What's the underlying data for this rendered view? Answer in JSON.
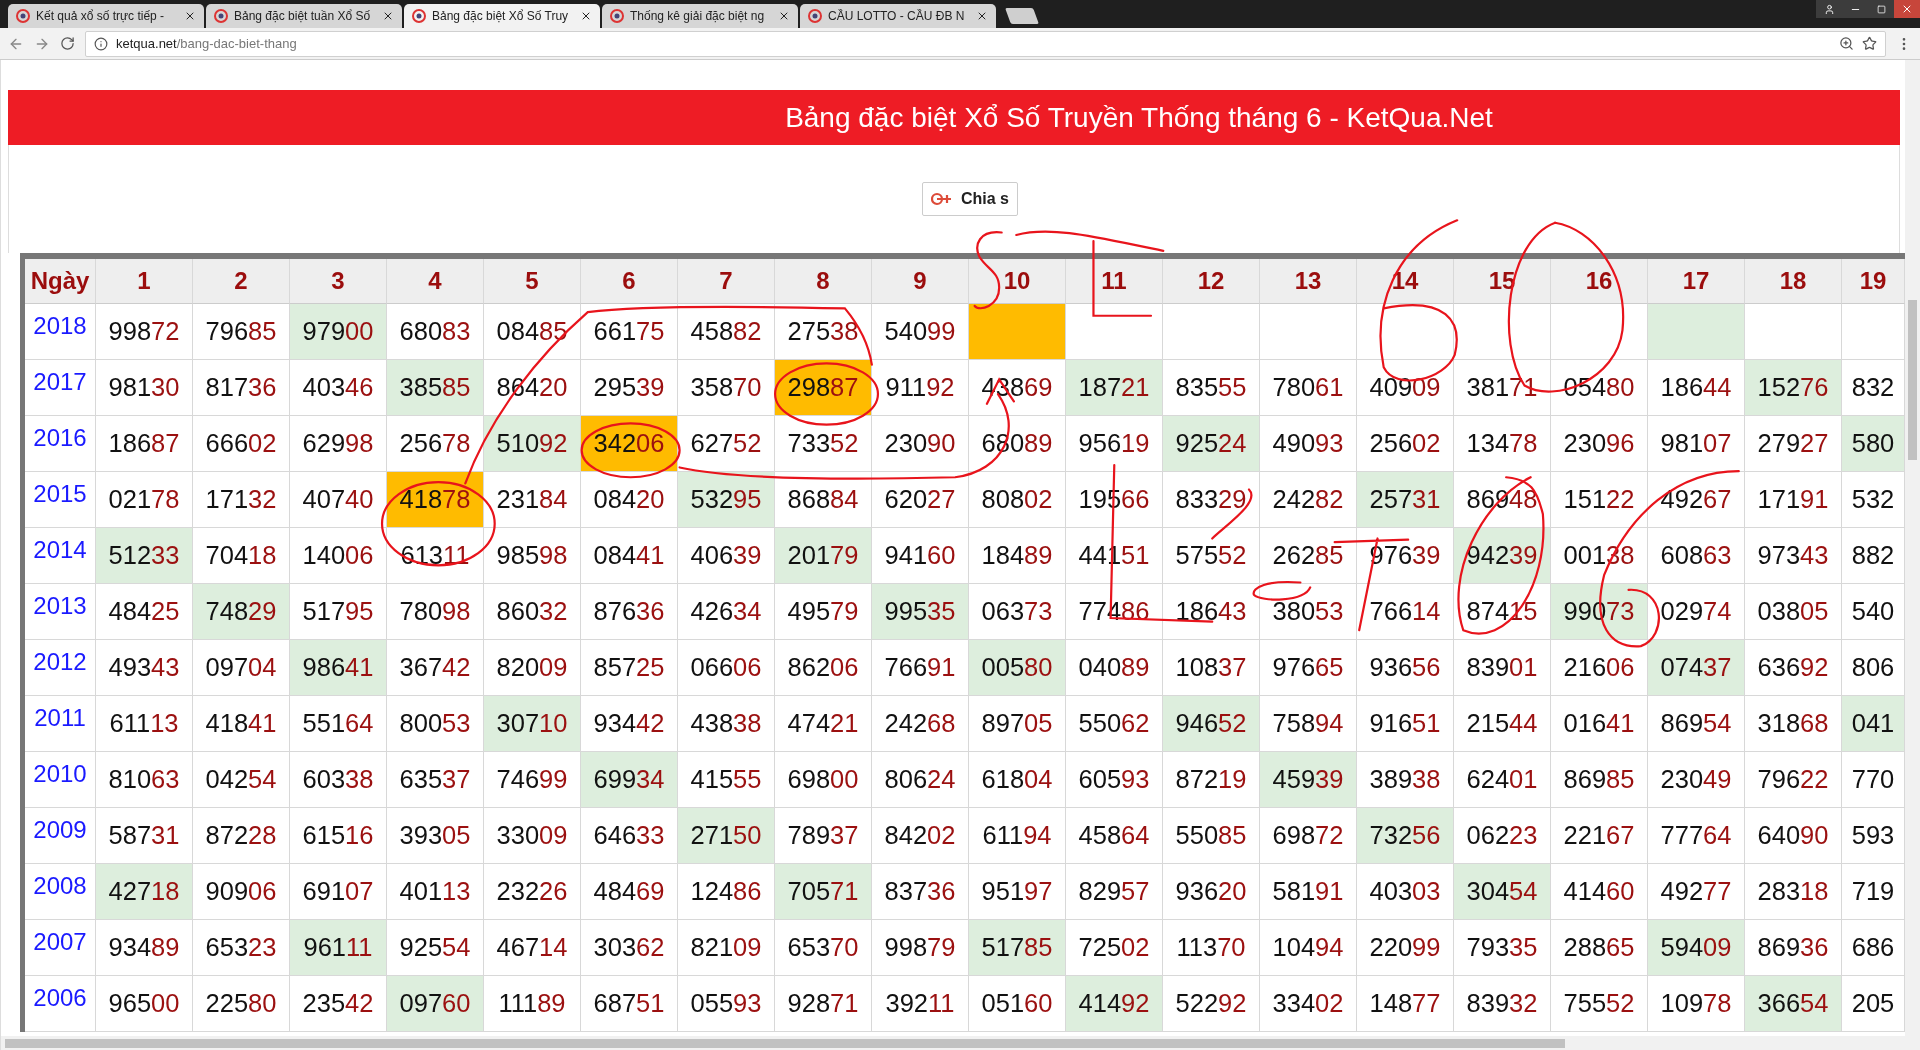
{
  "browser": {
    "tabs": [
      {
        "title": "Kết quả xổ số trực tiếp -",
        "selected": false
      },
      {
        "title": "Bảng đặc biệt tuần Xổ Số",
        "selected": false
      },
      {
        "title": "Bảng đặc biệt Xổ Số Truy",
        "selected": true
      },
      {
        "title": "Thống kê giải đặc biệt ng",
        "selected": false
      },
      {
        "title": "CẦU LOTTO - CẦU ĐB N",
        "selected": false
      }
    ],
    "address": {
      "domain": "ketqua.net",
      "path": "/bang-dac-biet-thang"
    }
  },
  "banner": {
    "title": "Bảng đặc biệt Xổ Số Truyền Thống tháng 6 - KetQua.Net"
  },
  "share_button": {
    "label": "Chia s"
  },
  "table": {
    "columns": [
      "Ngày",
      "1",
      "2",
      "3",
      "4",
      "5",
      "6",
      "7",
      "8",
      "9",
      "10",
      "11",
      "12",
      "13",
      "14",
      "15",
      "16",
      "17",
      "18",
      "19"
    ],
    "rows": [
      {
        "cells": [
          {
            "kind": "year",
            "value": "2018"
          },
          {
            "kind": "number",
            "value": "99872",
            "color": "#ffffff"
          },
          {
            "kind": "number",
            "value": "79685",
            "color": "#ffffff"
          },
          {
            "kind": "number",
            "value": "97900",
            "color": "#ddeedd"
          },
          {
            "kind": "number",
            "value": "68083",
            "color": "#ffffff"
          },
          {
            "kind": "number",
            "value": "08485",
            "color": "#ffffff"
          },
          {
            "kind": "number",
            "value": "66175",
            "color": "#ffffff"
          },
          {
            "kind": "number",
            "value": "45882",
            "color": "#ffffff"
          },
          {
            "kind": "number",
            "value": "27538",
            "color": "#ffffff"
          },
          {
            "kind": "number",
            "value": "54099",
            "color": "#ffffff"
          },
          {
            "kind": "number",
            "color": "#ffbb00"
          },
          {
            "kind": "number",
            "color": "#ffffff"
          },
          {
            "kind": "number",
            "color": "#ffffff"
          },
          {
            "kind": "number",
            "color": "#ffffff"
          },
          {
            "kind": "number",
            "color": "#ffffff"
          },
          {
            "kind": "number",
            "color": "#ffffff"
          },
          {
            "kind": "number",
            "color": "#ffffff"
          },
          {
            "kind": "number",
            "color": "#ddeedd"
          },
          {
            "kind": "number",
            "color": "#ffffff"
          },
          {
            "kind": "number",
            "color": "#ffffff"
          }
        ]
      },
      {
        "cells": [
          {
            "kind": "year",
            "value": "2017"
          },
          {
            "kind": "number",
            "value": "98130",
            "color": "#ffffff"
          },
          {
            "kind": "number",
            "value": "81736",
            "color": "#ffffff"
          },
          {
            "kind": "number",
            "value": "40346",
            "color": "#ffffff"
          },
          {
            "kind": "number",
            "value": "38585",
            "color": "#ddeedd"
          },
          {
            "kind": "number",
            "value": "86420",
            "color": "#ffffff"
          },
          {
            "kind": "number",
            "value": "29539",
            "color": "#ffffff"
          },
          {
            "kind": "number",
            "value": "35870",
            "color": "#ffffff"
          },
          {
            "kind": "number",
            "value": "29887",
            "color": "#ffbb00"
          },
          {
            "kind": "number",
            "value": "91192",
            "color": "#ffffff"
          },
          {
            "kind": "number",
            "value": "43869",
            "color": "#ffffff"
          },
          {
            "kind": "number",
            "value": "18721",
            "color": "#ddeedd"
          },
          {
            "kind": "number",
            "value": "83555",
            "color": "#ffffff"
          },
          {
            "kind": "number",
            "value": "78061",
            "color": "#ffffff"
          },
          {
            "kind": "number",
            "value": "40909",
            "color": "#ffffff"
          },
          {
            "kind": "number",
            "value": "38171",
            "color": "#ffffff"
          },
          {
            "kind": "number",
            "value": "05480",
            "color": "#ffffff"
          },
          {
            "kind": "number",
            "value": "18644",
            "color": "#ffffff"
          },
          {
            "kind": "number",
            "value": "15276",
            "color": "#ddeedd"
          },
          {
            "kind": "number",
            "value": "832",
            "color": "#ffffff"
          }
        ]
      },
      {
        "cells": [
          {
            "kind": "year",
            "value": "2016"
          },
          {
            "kind": "number",
            "value": "18687",
            "color": "#ffffff"
          },
          {
            "kind": "number",
            "value": "66602",
            "color": "#ffffff"
          },
          {
            "kind": "number",
            "value": "62998",
            "color": "#ffffff"
          },
          {
            "kind": "number",
            "value": "25678",
            "color": "#ffffff"
          },
          {
            "kind": "number",
            "value": "51092",
            "color": "#ddeedd"
          },
          {
            "kind": "number",
            "value": "34206",
            "color": "#ffbb00"
          },
          {
            "kind": "number",
            "value": "62752",
            "color": "#ffffff"
          },
          {
            "kind": "number",
            "value": "73352",
            "color": "#ffffff"
          },
          {
            "kind": "number",
            "value": "23090",
            "color": "#ffffff"
          },
          {
            "kind": "number",
            "value": "68089",
            "color": "#ffffff"
          },
          {
            "kind": "number",
            "value": "95619",
            "color": "#ffffff"
          },
          {
            "kind": "number",
            "value": "92524",
            "color": "#ddeedd"
          },
          {
            "kind": "number",
            "value": "49093",
            "color": "#ffffff"
          },
          {
            "kind": "number",
            "value": "25602",
            "color": "#ffffff"
          },
          {
            "kind": "number",
            "value": "13478",
            "color": "#ffffff"
          },
          {
            "kind": "number",
            "value": "23096",
            "color": "#ffffff"
          },
          {
            "kind": "number",
            "value": "98107",
            "color": "#ffffff"
          },
          {
            "kind": "number",
            "value": "27927",
            "color": "#ffffff"
          },
          {
            "kind": "number",
            "value": "580",
            "color": "#ddeedd"
          }
        ]
      },
      {
        "cells": [
          {
            "kind": "year",
            "value": "2015"
          },
          {
            "kind": "number",
            "value": "02178",
            "color": "#ffffff"
          },
          {
            "kind": "number",
            "value": "17132",
            "color": "#ffffff"
          },
          {
            "kind": "number",
            "value": "40740",
            "color": "#ffffff"
          },
          {
            "kind": "number",
            "value": "41878",
            "color": "#ffbb00"
          },
          {
            "kind": "number",
            "value": "23184",
            "color": "#ffffff"
          },
          {
            "kind": "number",
            "value": "08420",
            "color": "#ffffff"
          },
          {
            "kind": "number",
            "value": "53295",
            "color": "#ddeedd"
          },
          {
            "kind": "number",
            "value": "86884",
            "color": "#ffffff"
          },
          {
            "kind": "number",
            "value": "62027",
            "color": "#ffffff"
          },
          {
            "kind": "number",
            "value": "80802",
            "color": "#ffffff"
          },
          {
            "kind": "number",
            "value": "19566",
            "color": "#ffffff"
          },
          {
            "kind": "number",
            "value": "83329",
            "color": "#ffffff"
          },
          {
            "kind": "number",
            "value": "24282",
            "color": "#ffffff"
          },
          {
            "kind": "number",
            "value": "25731",
            "color": "#ddeedd"
          },
          {
            "kind": "number",
            "value": "86948",
            "color": "#ffffff"
          },
          {
            "kind": "number",
            "value": "15122",
            "color": "#ffffff"
          },
          {
            "kind": "number",
            "value": "49267",
            "color": "#ffffff"
          },
          {
            "kind": "number",
            "value": "17191",
            "color": "#ffffff"
          },
          {
            "kind": "number",
            "value": "532",
            "color": "#ffffff"
          }
        ]
      },
      {
        "cells": [
          {
            "kind": "year",
            "value": "2014"
          },
          {
            "kind": "number",
            "value": "51233",
            "color": "#ddeedd"
          },
          {
            "kind": "number",
            "value": "70418",
            "color": "#ffffff"
          },
          {
            "kind": "number",
            "value": "14006",
            "color": "#ffffff"
          },
          {
            "kind": "number",
            "value": "61311",
            "color": "#ffffff"
          },
          {
            "kind": "number",
            "value": "98598",
            "color": "#ffffff"
          },
          {
            "kind": "number",
            "value": "08441",
            "color": "#ffffff"
          },
          {
            "kind": "number",
            "value": "40639",
            "color": "#ffffff"
          },
          {
            "kind": "number",
            "value": "20179",
            "color": "#ddeedd"
          },
          {
            "kind": "number",
            "value": "94160",
            "color": "#ffffff"
          },
          {
            "kind": "number",
            "value": "18489",
            "color": "#ffffff"
          },
          {
            "kind": "number",
            "value": "44151",
            "color": "#ffffff"
          },
          {
            "kind": "number",
            "value": "57552",
            "color": "#ffffff"
          },
          {
            "kind": "number",
            "value": "26285",
            "color": "#ffffff"
          },
          {
            "kind": "number",
            "value": "97639",
            "color": "#ffffff"
          },
          {
            "kind": "number",
            "value": "94239",
            "color": "#ddeedd"
          },
          {
            "kind": "number",
            "value": "00138",
            "color": "#ffffff"
          },
          {
            "kind": "number",
            "value": "60863",
            "color": "#ffffff"
          },
          {
            "kind": "number",
            "value": "97343",
            "color": "#ffffff"
          },
          {
            "kind": "number",
            "value": "882",
            "color": "#ffffff"
          }
        ]
      },
      {
        "cells": [
          {
            "kind": "year",
            "value": "2013"
          },
          {
            "kind": "number",
            "value": "48425",
            "color": "#ffffff"
          },
          {
            "kind": "number",
            "value": "74829",
            "color": "#ddeedd"
          },
          {
            "kind": "number",
            "value": "51795",
            "color": "#ffffff"
          },
          {
            "kind": "number",
            "value": "78098",
            "color": "#ffffff"
          },
          {
            "kind": "number",
            "value": "86032",
            "color": "#ffffff"
          },
          {
            "kind": "number",
            "value": "87636",
            "color": "#ffffff"
          },
          {
            "kind": "number",
            "value": "42634",
            "color": "#ffffff"
          },
          {
            "kind": "number",
            "value": "49579",
            "color": "#ffffff"
          },
          {
            "kind": "number",
            "value": "99535",
            "color": "#ddeedd"
          },
          {
            "kind": "number",
            "value": "06373",
            "color": "#ffffff"
          },
          {
            "kind": "number",
            "value": "77486",
            "color": "#ffffff"
          },
          {
            "kind": "number",
            "value": "18643",
            "color": "#ffffff"
          },
          {
            "kind": "number",
            "value": "38053",
            "color": "#ffffff"
          },
          {
            "kind": "number",
            "value": "76614",
            "color": "#ffffff"
          },
          {
            "kind": "number",
            "value": "87415",
            "color": "#ffffff"
          },
          {
            "kind": "number",
            "value": "99073",
            "color": "#ddeedd"
          },
          {
            "kind": "number",
            "value": "02974",
            "color": "#ffffff"
          },
          {
            "kind": "number",
            "value": "03805",
            "color": "#ffffff"
          },
          {
            "kind": "number",
            "value": "540",
            "color": "#ffffff"
          }
        ]
      },
      {
        "cells": [
          {
            "kind": "year",
            "value": "2012"
          },
          {
            "kind": "number",
            "value": "49343",
            "color": "#ffffff"
          },
          {
            "kind": "number",
            "value": "09704",
            "color": "#ffffff"
          },
          {
            "kind": "number",
            "value": "98641",
            "color": "#ddeedd"
          },
          {
            "kind": "number",
            "value": "36742",
            "color": "#ffffff"
          },
          {
            "kind": "number",
            "value": "82009",
            "color": "#ffffff"
          },
          {
            "kind": "number",
            "value": "85725",
            "color": "#ffffff"
          },
          {
            "kind": "number",
            "value": "06606",
            "color": "#ffffff"
          },
          {
            "kind": "number",
            "value": "86206",
            "color": "#ffffff"
          },
          {
            "kind": "number",
            "value": "76691",
            "color": "#ffffff"
          },
          {
            "kind": "number",
            "value": "00580",
            "color": "#ddeedd"
          },
          {
            "kind": "number",
            "value": "04089",
            "color": "#ffffff"
          },
          {
            "kind": "number",
            "value": "10837",
            "color": "#ffffff"
          },
          {
            "kind": "number",
            "value": "97665",
            "color": "#ffffff"
          },
          {
            "kind": "number",
            "value": "93656",
            "color": "#ffffff"
          },
          {
            "kind": "number",
            "value": "83901",
            "color": "#ffffff"
          },
          {
            "kind": "number",
            "value": "21606",
            "color": "#ffffff"
          },
          {
            "kind": "number",
            "value": "07437",
            "color": "#ddeedd"
          },
          {
            "kind": "number",
            "value": "63692",
            "color": "#ffffff"
          },
          {
            "kind": "number",
            "value": "806",
            "color": "#ffffff"
          }
        ]
      },
      {
        "cells": [
          {
            "kind": "year",
            "value": "2011"
          },
          {
            "kind": "number",
            "value": "61113",
            "color": "#ffffff"
          },
          {
            "kind": "number",
            "value": "41841",
            "color": "#ffffff"
          },
          {
            "kind": "number",
            "value": "55164",
            "color": "#ffffff"
          },
          {
            "kind": "number",
            "value": "80053",
            "color": "#ffffff"
          },
          {
            "kind": "number",
            "value": "30710",
            "color": "#ddeedd"
          },
          {
            "kind": "number",
            "value": "93442",
            "color": "#ffffff"
          },
          {
            "kind": "number",
            "value": "43838",
            "color": "#ffffff"
          },
          {
            "kind": "number",
            "value": "47421",
            "color": "#ffffff"
          },
          {
            "kind": "number",
            "value": "24268",
            "color": "#ffffff"
          },
          {
            "kind": "number",
            "value": "89705",
            "color": "#ffffff"
          },
          {
            "kind": "number",
            "value": "55062",
            "color": "#ffffff"
          },
          {
            "kind": "number",
            "value": "94652",
            "color": "#ddeedd"
          },
          {
            "kind": "number",
            "value": "75894",
            "color": "#ffffff"
          },
          {
            "kind": "number",
            "value": "91651",
            "color": "#ffffff"
          },
          {
            "kind": "number",
            "value": "21544",
            "color": "#ffffff"
          },
          {
            "kind": "number",
            "value": "01641",
            "color": "#ffffff"
          },
          {
            "kind": "number",
            "value": "86954",
            "color": "#ffffff"
          },
          {
            "kind": "number",
            "value": "31868",
            "color": "#ffffff"
          },
          {
            "kind": "number",
            "value": "041",
            "color": "#ddeedd"
          }
        ]
      },
      {
        "cells": [
          {
            "kind": "year",
            "value": "2010"
          },
          {
            "kind": "number",
            "value": "81063",
            "color": "#ffffff"
          },
          {
            "kind": "number",
            "value": "04254",
            "color": "#ffffff"
          },
          {
            "kind": "number",
            "value": "60338",
            "color": "#ffffff"
          },
          {
            "kind": "number",
            "value": "63537",
            "color": "#ffffff"
          },
          {
            "kind": "number",
            "value": "74699",
            "color": "#ffffff"
          },
          {
            "kind": "number",
            "value": "69934",
            "color": "#ddeedd"
          },
          {
            "kind": "number",
            "value": "41555",
            "color": "#ffffff"
          },
          {
            "kind": "number",
            "value": "69800",
            "color": "#ffffff"
          },
          {
            "kind": "number",
            "value": "80624",
            "color": "#ffffff"
          },
          {
            "kind": "number",
            "value": "61804",
            "color": "#ffffff"
          },
          {
            "kind": "number",
            "value": "60593",
            "color": "#ffffff"
          },
          {
            "kind": "number",
            "value": "87219",
            "color": "#ffffff"
          },
          {
            "kind": "number",
            "value": "45939",
            "color": "#ddeedd"
          },
          {
            "kind": "number",
            "value": "38938",
            "color": "#ffffff"
          },
          {
            "kind": "number",
            "value": "62401",
            "color": "#ffffff"
          },
          {
            "kind": "number",
            "value": "86985",
            "color": "#ffffff"
          },
          {
            "kind": "number",
            "value": "23049",
            "color": "#ffffff"
          },
          {
            "kind": "number",
            "value": "79622",
            "color": "#ffffff"
          },
          {
            "kind": "number",
            "value": "770",
            "color": "#ffffff"
          }
        ]
      },
      {
        "cells": [
          {
            "kind": "year",
            "value": "2009"
          },
          {
            "kind": "number",
            "value": "58731",
            "color": "#ffffff"
          },
          {
            "kind": "number",
            "value": "87228",
            "color": "#ffffff"
          },
          {
            "kind": "number",
            "value": "61516",
            "color": "#ffffff"
          },
          {
            "kind": "number",
            "value": "39305",
            "color": "#ffffff"
          },
          {
            "kind": "number",
            "value": "33009",
            "color": "#ffffff"
          },
          {
            "kind": "number",
            "value": "64633",
            "color": "#ffffff"
          },
          {
            "kind": "number",
            "value": "27150",
            "color": "#ddeedd"
          },
          {
            "kind": "number",
            "value": "78937",
            "color": "#ffffff"
          },
          {
            "kind": "number",
            "value": "84202",
            "color": "#ffffff"
          },
          {
            "kind": "number",
            "value": "61194",
            "color": "#ffffff"
          },
          {
            "kind": "number",
            "value": "45864",
            "color": "#ffffff"
          },
          {
            "kind": "number",
            "value": "55085",
            "color": "#ffffff"
          },
          {
            "kind": "number",
            "value": "69872",
            "color": "#ffffff"
          },
          {
            "kind": "number",
            "value": "73256",
            "color": "#ddeedd"
          },
          {
            "kind": "number",
            "value": "06223",
            "color": "#ffffff"
          },
          {
            "kind": "number",
            "value": "22167",
            "color": "#ffffff"
          },
          {
            "kind": "number",
            "value": "77764",
            "color": "#ffffff"
          },
          {
            "kind": "number",
            "value": "64090",
            "color": "#ffffff"
          },
          {
            "kind": "number",
            "value": "593",
            "color": "#ffffff"
          }
        ]
      },
      {
        "cells": [
          {
            "kind": "year",
            "value": "2008"
          },
          {
            "kind": "number",
            "value": "42718",
            "color": "#ddeedd"
          },
          {
            "kind": "number",
            "value": "90906",
            "color": "#ffffff"
          },
          {
            "kind": "number",
            "value": "69107",
            "color": "#ffffff"
          },
          {
            "kind": "number",
            "value": "40113",
            "color": "#ffffff"
          },
          {
            "kind": "number",
            "value": "23226",
            "color": "#ffffff"
          },
          {
            "kind": "number",
            "value": "48469",
            "color": "#ffffff"
          },
          {
            "kind": "number",
            "value": "12486",
            "color": "#ffffff"
          },
          {
            "kind": "number",
            "value": "70571",
            "color": "#ddeedd"
          },
          {
            "kind": "number",
            "value": "83736",
            "color": "#ffffff"
          },
          {
            "kind": "number",
            "value": "95197",
            "color": "#ffffff"
          },
          {
            "kind": "number",
            "value": "82957",
            "color": "#ffffff"
          },
          {
            "kind": "number",
            "value": "93620",
            "color": "#ffffff"
          },
          {
            "kind": "number",
            "value": "58191",
            "color": "#ffffff"
          },
          {
            "kind": "number",
            "value": "40303",
            "color": "#ffffff"
          },
          {
            "kind": "number",
            "value": "30454",
            "color": "#ddeedd"
          },
          {
            "kind": "number",
            "value": "41460",
            "color": "#ffffff"
          },
          {
            "kind": "number",
            "value": "49277",
            "color": "#ffffff"
          },
          {
            "kind": "number",
            "value": "28318",
            "color": "#ffffff"
          },
          {
            "kind": "number",
            "value": "719",
            "color": "#ffffff"
          }
        ]
      },
      {
        "cells": [
          {
            "kind": "year",
            "value": "2007"
          },
          {
            "kind": "number",
            "value": "93489",
            "color": "#ffffff"
          },
          {
            "kind": "number",
            "value": "65323",
            "color": "#ffffff"
          },
          {
            "kind": "number",
            "value": "96111",
            "color": "#ddeedd"
          },
          {
            "kind": "number",
            "value": "92554",
            "color": "#ffffff"
          },
          {
            "kind": "number",
            "value": "46714",
            "color": "#ffffff"
          },
          {
            "kind": "number",
            "value": "30362",
            "color": "#ffffff"
          },
          {
            "kind": "number",
            "value": "82109",
            "color": "#ffffff"
          },
          {
            "kind": "number",
            "value": "65370",
            "color": "#ffffff"
          },
          {
            "kind": "number",
            "value": "99879",
            "color": "#ffffff"
          },
          {
            "kind": "number",
            "value": "51785",
            "color": "#ddeedd"
          },
          {
            "kind": "number",
            "value": "72502",
            "color": "#ffffff"
          },
          {
            "kind": "number",
            "value": "11370",
            "color": "#ffffff"
          },
          {
            "kind": "number",
            "value": "10494",
            "color": "#ffffff"
          },
          {
            "kind": "number",
            "value": "22099",
            "color": "#ffffff"
          },
          {
            "kind": "number",
            "value": "79335",
            "color": "#ffffff"
          },
          {
            "kind": "number",
            "value": "28865",
            "color": "#ffffff"
          },
          {
            "kind": "number",
            "value": "59409",
            "color": "#ddeedd"
          },
          {
            "kind": "number",
            "value": "86936",
            "color": "#ffffff"
          },
          {
            "kind": "number",
            "value": "686",
            "color": "#ffffff"
          }
        ]
      },
      {
        "cells": [
          {
            "kind": "year",
            "value": "2006"
          },
          {
            "kind": "number",
            "value": "96500",
            "color": "#ffffff"
          },
          {
            "kind": "number",
            "value": "22580",
            "color": "#ffffff"
          },
          {
            "kind": "number",
            "value": "23542",
            "color": "#ffffff"
          },
          {
            "kind": "number",
            "value": "09760",
            "color": "#ddeedd"
          },
          {
            "kind": "number",
            "value": "11189",
            "color": "#ffffff"
          },
          {
            "kind": "number",
            "value": "68751",
            "color": "#ffffff"
          },
          {
            "kind": "number",
            "value": "05593",
            "color": "#ffffff"
          },
          {
            "kind": "number",
            "value": "92871",
            "color": "#ffffff"
          },
          {
            "kind": "number",
            "value": "39211",
            "color": "#ffffff"
          },
          {
            "kind": "number",
            "value": "05160",
            "color": "#ffffff"
          },
          {
            "kind": "number",
            "value": "41492",
            "color": "#ddeedd"
          },
          {
            "kind": "number",
            "value": "52292",
            "color": "#ffffff"
          },
          {
            "kind": "number",
            "value": "33402",
            "color": "#ffffff"
          },
          {
            "kind": "number",
            "value": "14877",
            "color": "#ffffff"
          },
          {
            "kind": "number",
            "value": "83932",
            "color": "#ffffff"
          },
          {
            "kind": "number",
            "value": "75552",
            "color": "#ffffff"
          },
          {
            "kind": "number",
            "value": "10978",
            "color": "#ffffff"
          },
          {
            "kind": "number",
            "value": "36654",
            "color": "#ddeedd"
          },
          {
            "kind": "number",
            "value": "205",
            "color": "#ffffff"
          }
        ]
      }
    ]
  }
}
